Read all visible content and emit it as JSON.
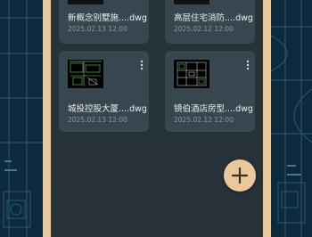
{
  "files": [
    {
      "name": "新概念别墅施....dwg",
      "date": "2025.02.13 12:00"
    },
    {
      "name": "高层住宅消防....dwg",
      "date": "2025.02.12 12:00"
    },
    {
      "name": "城投控股大厦....dwg",
      "date": "2025.02.13 12:00"
    },
    {
      "name": "镜伯酒店房型....dwg",
      "date": "2025.02.12 12:00"
    }
  ],
  "icons": {
    "more": "more-vertical-icon",
    "fab": "plus-icon"
  },
  "colors": {
    "panel": "#263238",
    "card": "#37474f",
    "accent": "#e9c99a",
    "filename": "#eceff1",
    "date": "#8a979d"
  }
}
